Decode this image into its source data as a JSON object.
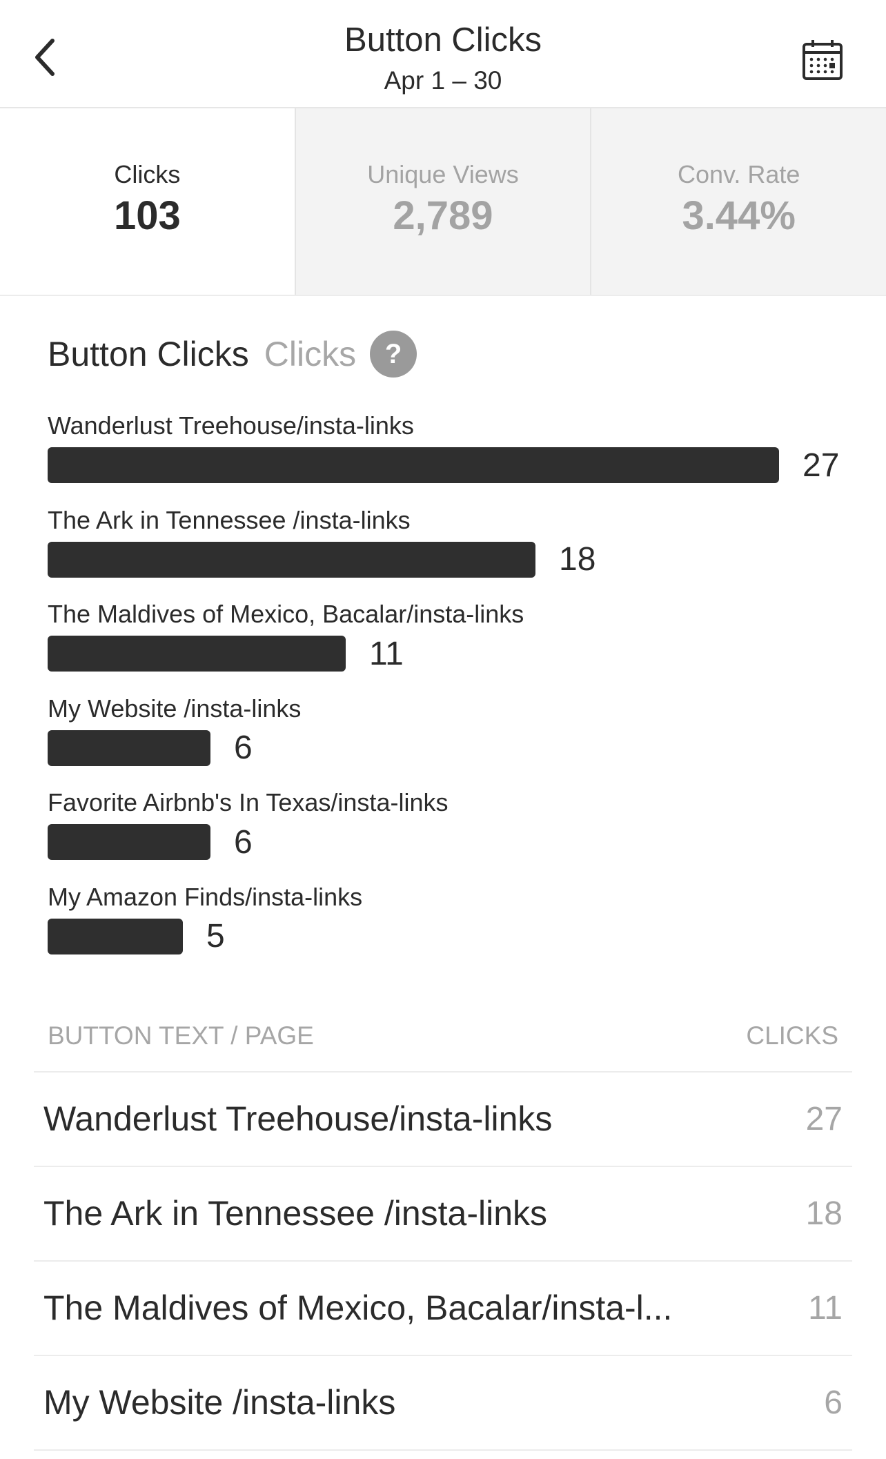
{
  "header": {
    "title": "Button Clicks",
    "date_range": "Apr 1 – 30",
    "back_icon": "chevron-left-icon",
    "calendar_icon": "calendar-icon"
  },
  "stats": [
    {
      "label": "Clicks",
      "value": "103",
      "active": true
    },
    {
      "label": "Unique Views",
      "value": "2,789",
      "active": false
    },
    {
      "label": "Conv. Rate",
      "value": "3.44%",
      "active": false
    }
  ],
  "section": {
    "title": "Button Clicks",
    "metric": "Clicks",
    "help_glyph": "?"
  },
  "chart_data": {
    "type": "bar",
    "orientation": "horizontal",
    "categories": [
      "Wanderlust Treehouse/insta-links",
      "The Ark in Tennessee /insta-links",
      "The Maldives of Mexico, Bacalar/insta-links",
      "My Website /insta-links",
      "Favorite Airbnb's In Texas/insta-links",
      "My Amazon Finds/insta-links"
    ],
    "values": [
      27,
      18,
      11,
      6,
      6,
      5
    ],
    "bar_color": "#2f2f2f"
  },
  "table": {
    "col_left": "BUTTON TEXT / PAGE",
    "col_right": "CLICKS",
    "rows": [
      {
        "name": "Wanderlust Treehouse/insta-links",
        "clicks": "27"
      },
      {
        "name": "The Ark in Tennessee /insta-links",
        "clicks": "18"
      },
      {
        "name": "The Maldives of Mexico, Bacalar/insta-l...",
        "clicks": "11"
      },
      {
        "name": "My Website /insta-links",
        "clicks": "6"
      }
    ]
  }
}
